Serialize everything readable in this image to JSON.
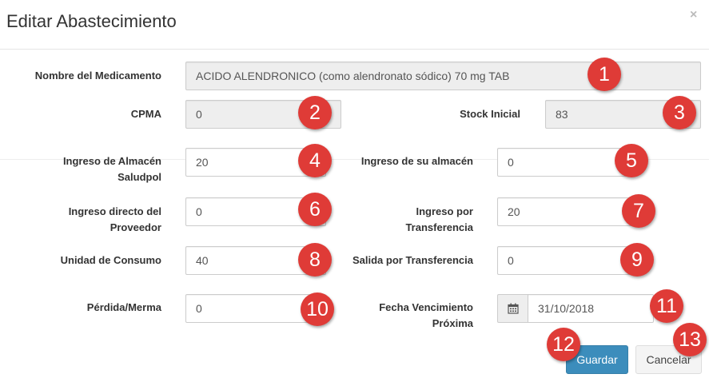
{
  "modal": {
    "title": "Editar Abastecimiento",
    "close_label": "×"
  },
  "fields": {
    "nombre_medicamento": {
      "label": "Nombre del Medicamento",
      "value": "ACIDO ALENDRONICO (como alendronato sódico) 70 mg TAB"
    },
    "cpma": {
      "label": "CPMA",
      "value": "0"
    },
    "stock_inicial": {
      "label": "Stock Inicial",
      "value": "83"
    },
    "ingreso_almacen_saludpol": {
      "label_line1": "Ingreso de Almacén",
      "label_line2": "Saludpol",
      "value": "20"
    },
    "ingreso_su_almacen": {
      "label": "Ingreso de su almacén",
      "value": "0"
    },
    "ingreso_directo_proveedor": {
      "label_line1": "Ingreso directo del",
      "label_line2": "Proveedor",
      "value": "0"
    },
    "ingreso_transferencia": {
      "label_line1": "Ingreso por",
      "label_line2": "Transferencia",
      "value": "20"
    },
    "unidad_consumo": {
      "label": "Unidad de Consumo",
      "value": "40"
    },
    "salida_transferencia": {
      "label": "Salida por Transferencia",
      "value": "0"
    },
    "perdida_merma": {
      "label": "Pérdida/Merma",
      "value": "0"
    },
    "fecha_vencimiento": {
      "label_line1": "Fecha Vencimiento",
      "label_line2": "Próxima",
      "value": "31/10/2018",
      "icon": "calendar-icon"
    }
  },
  "buttons": {
    "guardar": "Guardar",
    "cancelar": "Cancelar"
  },
  "annotations": [
    "1",
    "2",
    "3",
    "4",
    "5",
    "6",
    "7",
    "8",
    "9",
    "10",
    "11",
    "12",
    "13"
  ],
  "colors": {
    "primary": "#3c8dbc",
    "badge": "#df3b37",
    "readonly_bg": "#eeeeee"
  }
}
